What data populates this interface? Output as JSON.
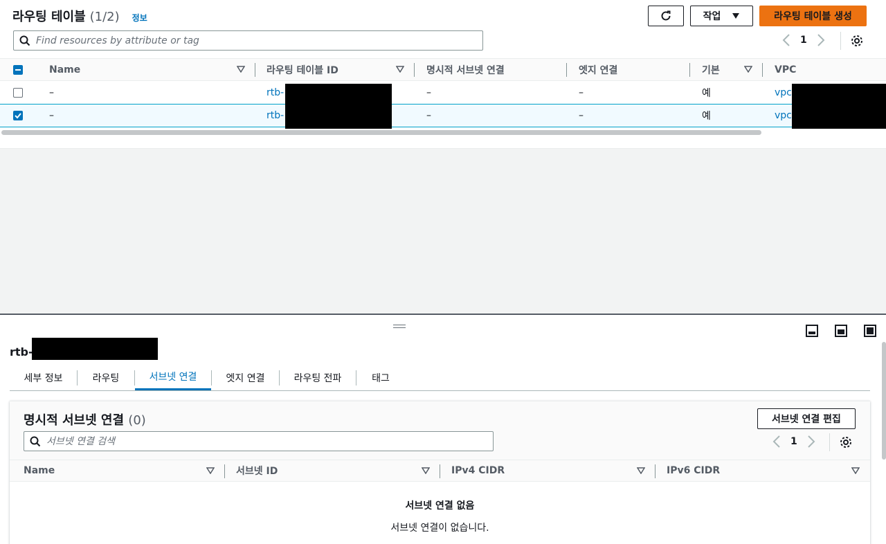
{
  "header": {
    "title": "라우팅 테이블",
    "count": "(1/2)",
    "info_link": "정보",
    "refresh_icon": "refresh-icon",
    "actions_label": "작업",
    "create_label": "라우팅 테이블 생성"
  },
  "search": {
    "placeholder": "Find resources by attribute or tag"
  },
  "pagination": {
    "page": "1"
  },
  "table": {
    "columns": [
      "Name",
      "라우팅 테이블 ID",
      "명시적 서브넷 연결",
      "엣지 연결",
      "기본",
      "VPC"
    ],
    "rows": [
      {
        "selected": false,
        "name": "–",
        "id": "rtb-",
        "subnet": "–",
        "edge": "–",
        "main": "예",
        "vpc": "vpc-"
      },
      {
        "selected": true,
        "name": "–",
        "id": "rtb-",
        "subnet": "–",
        "edge": "–",
        "main": "예",
        "vpc": "vpc-"
      }
    ]
  },
  "detail": {
    "title": "rtb-0",
    "tabs": [
      "세부 정보",
      "라우팅",
      "서브넷 연결",
      "엣지 연결",
      "라우팅 전파",
      "태그"
    ],
    "active_tab": "서브넷 연결"
  },
  "subnet_panel": {
    "title": "명시적 서브넷 연결",
    "count": "(0)",
    "edit_label": "서브넷 연결 편집",
    "search_placeholder": "서브넷 연결 검색",
    "page": "1",
    "columns": [
      "Name",
      "서브넷 ID",
      "IPv4 CIDR",
      "IPv6 CIDR"
    ],
    "empty_title": "서브넷 연결 없음",
    "empty_message": "서브넷 연결이 없습니다."
  },
  "colors": {
    "primary": "#ec7211",
    "link": "#0073bb",
    "selected_bg": "#f1faff"
  }
}
